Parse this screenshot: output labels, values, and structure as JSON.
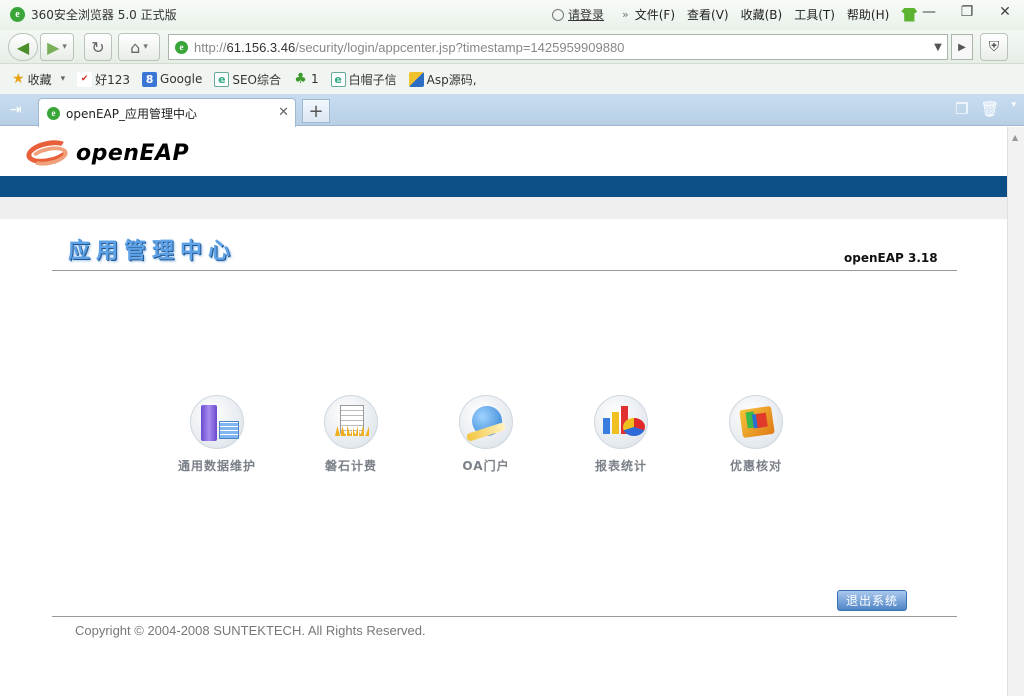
{
  "browser": {
    "title": "360安全浏览器 5.0 正式版",
    "login_link": "请登录",
    "menu": [
      "文件(F)",
      "查看(V)",
      "收藏(B)",
      "工具(T)",
      "帮助(H)"
    ],
    "url_prefix": "http://",
    "url_host": "61.156.3.46",
    "url_path": "/security/login/appcenter.jsp?timestamp=1425959909880",
    "bookmarks": [
      {
        "label": "收藏",
        "icon": "star-icon"
      },
      {
        "label": "好123",
        "icon": "hao123-icon"
      },
      {
        "label": "Google",
        "icon": "google-icon"
      },
      {
        "label": "SEO综合",
        "icon": "page-icon"
      },
      {
        "label": "1",
        "icon": "person-icon"
      },
      {
        "label": "白帽子信",
        "icon": "page-icon"
      },
      {
        "label": "Asp源码,",
        "icon": "image-icon"
      }
    ],
    "active_tab": "openEAP_应用管理中心"
  },
  "page": {
    "logo_text": "openEAP",
    "title": "应用管理中心",
    "version": "openEAP 3.18",
    "apps": [
      {
        "label": "通用数据维护",
        "icon": "server-icon"
      },
      {
        "label": "磐石计费",
        "icon": "document-icon"
      },
      {
        "label": "OA门户",
        "icon": "globe-icon"
      },
      {
        "label": "报表统计",
        "icon": "chart-icon"
      },
      {
        "label": "优惠核对",
        "icon": "box-icon"
      }
    ],
    "logout_label": "退出系统",
    "copyright": "Copyright © 2004-2008 SUNTEKTECH. All Rights Reserved."
  },
  "colors": {
    "header_band": "#0b4f86",
    "title_blue": "#5da2e6",
    "tabbar": "#c9ddf0"
  }
}
